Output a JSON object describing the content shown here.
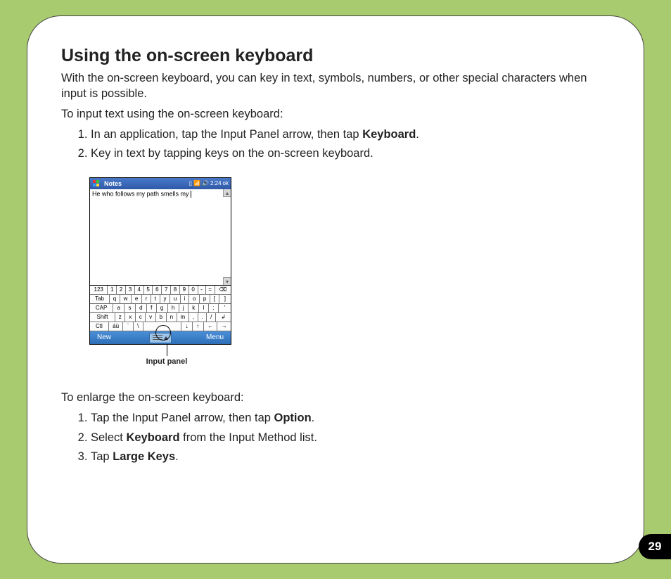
{
  "title": "Using the on-screen keyboard",
  "intro": "With the on-screen keyboard, you can key in text, symbols, numbers, or other special characters when input is possible.",
  "section1_lead": "To input text using the on-screen keyboard:",
  "section1_items": [
    {
      "pre": "In an application, tap the Input Panel arrow, then tap ",
      "bold": "Keyboard",
      "post": "."
    },
    {
      "pre": "Key in text by tapping keys on the on-screen keyboard.",
      "bold": "",
      "post": ""
    }
  ],
  "section2_lead": "To enlarge the on-screen keyboard:",
  "section2_items": [
    {
      "pre": "Tap the Input Panel arrow, then tap ",
      "bold": "Option",
      "post": "."
    },
    {
      "pre": "Select ",
      "bold": "Keyboard",
      "post": " from the Input Method list."
    },
    {
      "pre": "Tap ",
      "bold": "Large Keys",
      "post": "."
    }
  ],
  "callout_label": "Input panel",
  "page_number": "29",
  "device": {
    "app_title": "Notes",
    "status": {
      "signal": "▯",
      "antenna": "📶",
      "volume": "🔊",
      "time": "2:24",
      "ok": "ok"
    },
    "note_text": "He who follows my path smells my ",
    "menu_left": "New",
    "menu_right": "Menu",
    "kbd": {
      "row1": [
        "123",
        "1",
        "2",
        "3",
        "4",
        "5",
        "6",
        "7",
        "8",
        "9",
        "0",
        "-",
        "=",
        "⌫"
      ],
      "row2": [
        "Tab",
        "q",
        "w",
        "e",
        "r",
        "t",
        "y",
        "u",
        "i",
        "o",
        "p",
        "[",
        "]"
      ],
      "row3": [
        "CAP",
        "a",
        "s",
        "d",
        "f",
        "g",
        "h",
        "j",
        "k",
        "l",
        ";",
        "'"
      ],
      "row4": [
        "Shift",
        "z",
        "x",
        "c",
        "v",
        "b",
        "n",
        "m",
        ",",
        ".",
        "/",
        "↲"
      ],
      "row5": [
        "Ctl",
        "áü",
        "`",
        "\\",
        " ",
        "↓",
        "↑",
        "←",
        "→"
      ]
    }
  }
}
